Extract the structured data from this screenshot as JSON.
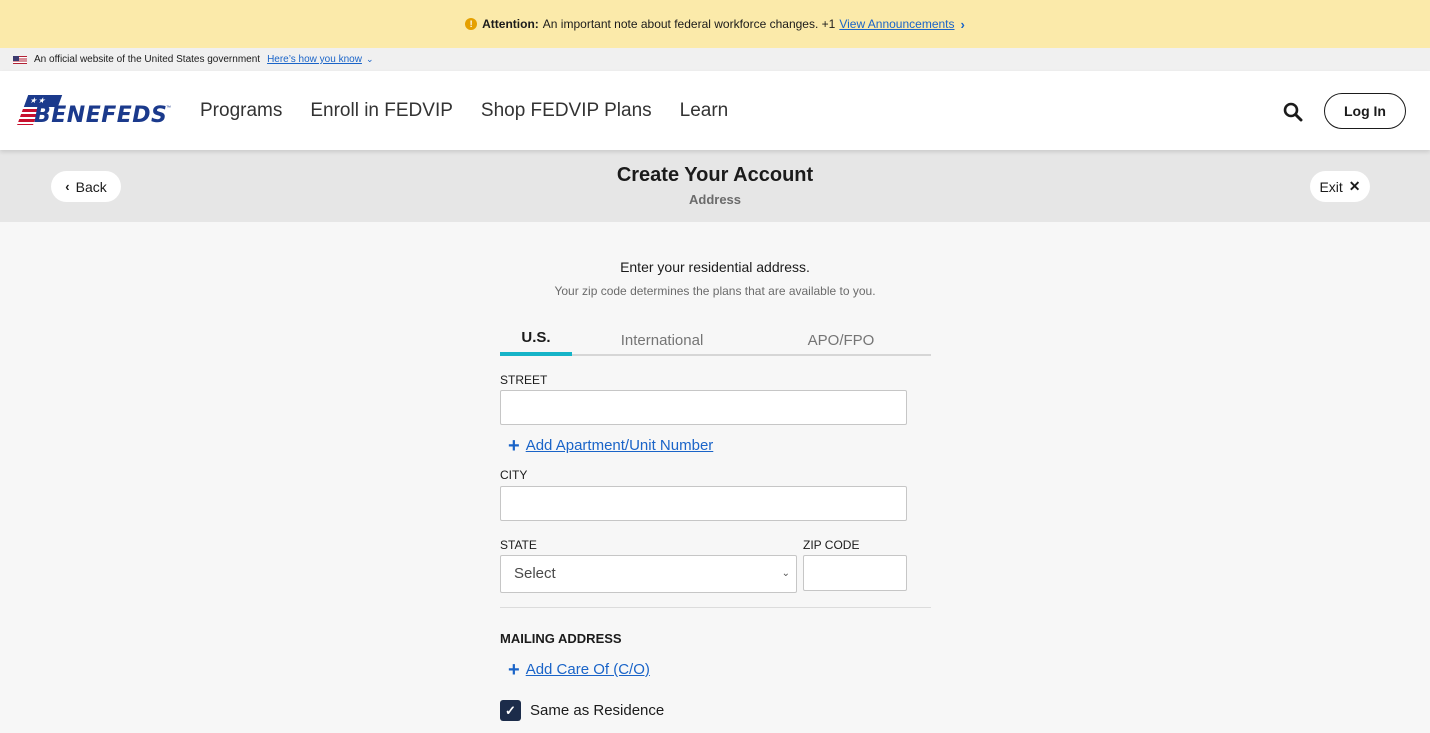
{
  "alert": {
    "bold": "Attention:",
    "message": "An important note about federal workforce changes. +1",
    "link": "View Announcements"
  },
  "gov_banner": {
    "text": "An official website of the United States government",
    "link": "Here’s how you know"
  },
  "header": {
    "logo_text": "BENEFEDS",
    "logo_tm": "™",
    "nav": [
      "Programs",
      "Enroll in FEDVIP",
      "Shop FEDVIP Plans",
      "Learn"
    ],
    "login_label": "Log In"
  },
  "page_head": {
    "back_label": "Back",
    "title": "Create Your Account",
    "subtitle": "Address",
    "exit_label": "Exit"
  },
  "form": {
    "intro": "Enter your residential address.",
    "intro_sub": "Your zip code determines the plans that are available to you.",
    "tabs": [
      {
        "label": "U.S.",
        "active": true
      },
      {
        "label": "International",
        "active": false
      },
      {
        "label": "APO/FPO",
        "active": false
      }
    ],
    "street_label": "STREET",
    "street_value": "",
    "add_apartment": "Add Apartment/Unit Number",
    "city_label": "CITY",
    "city_value": "",
    "state_label": "STATE",
    "state_selected": "Select",
    "zip_label": "ZIP CODE",
    "zip_value": "",
    "mailing_heading": "MAILING ADDRESS",
    "add_care_of": "Add Care Of (C/O)",
    "same_as_residence": "Same as Residence",
    "same_as_residence_checked": true
  },
  "colors": {
    "alert_bg": "#fbeaaa",
    "link": "#1a64c8",
    "tab_active_underline": "#16b4c8",
    "checkbox": "#1c2c4a",
    "brand_blue": "#1b3a8c",
    "brand_red": "#c8102e"
  }
}
